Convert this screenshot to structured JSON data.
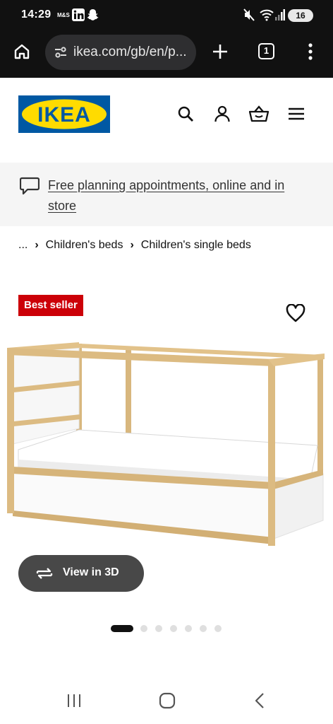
{
  "status_bar": {
    "time": "14:29",
    "small_label": "M&S",
    "battery": "16"
  },
  "browser": {
    "url": "ikea.com/gb/en/p...",
    "tab_count": "1"
  },
  "site": {
    "logo_text": "IKEA",
    "brand_colors": {
      "blue": "#0058a3",
      "yellow": "#ffdb00"
    }
  },
  "announcement": {
    "text": "Free planning appointments, online and in store"
  },
  "breadcrumb": {
    "items": [
      "...",
      "Children's beds",
      "Children's single beds"
    ]
  },
  "product": {
    "badge": "Best seller",
    "badge_color": "#cc0008",
    "view_3d_label": "View in 3D",
    "gallery_total": 7,
    "gallery_active_index": 0
  },
  "icons": {
    "browser": [
      "home-icon",
      "site-settings-icon",
      "new-tab-icon",
      "tab-switcher-icon",
      "more-menu-icon"
    ],
    "header": [
      "search-icon",
      "account-icon",
      "basket-icon",
      "menu-icon"
    ],
    "nav": [
      "recents-icon",
      "home-nav-icon",
      "back-icon"
    ]
  }
}
